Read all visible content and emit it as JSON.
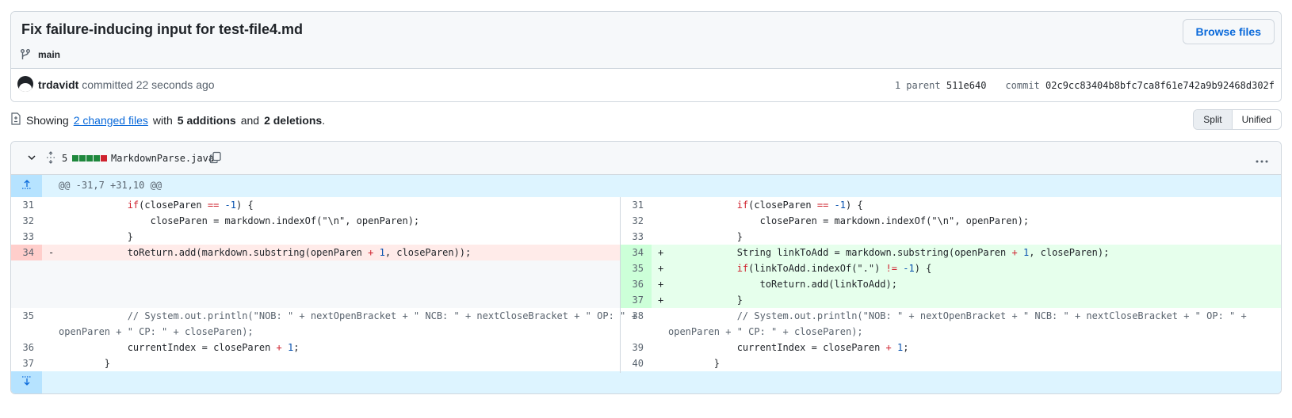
{
  "commit": {
    "title": "Fix failure-inducing input for test-file4.md",
    "branch": "main",
    "browse_button": "Browse files",
    "author": "trdavidt",
    "action": "committed 22 seconds ago",
    "parent_label": "1 parent",
    "parent_sha": "511e640",
    "commit_label": "commit",
    "commit_sha": "02c9cc83404b8bfc7ca8f61e742a9b92468d302f"
  },
  "summary": {
    "prefix": "Showing",
    "changed_files": "2 changed files",
    "with": "with",
    "additions": "5 additions",
    "and": "and",
    "deletions": "2 deletions",
    "suffix": "."
  },
  "view_toggle": {
    "split": "Split",
    "unified": "Unified",
    "active": "Split"
  },
  "file": {
    "change_count": "5",
    "name": "MarkdownParse.java",
    "diffstat_colors": [
      "#1f883d",
      "#1f883d",
      "#1f883d",
      "#1f883d",
      "#cf222e"
    ],
    "hunk_header": "@@ -31,7 +31,10 @@",
    "more_icon": "kebab-horizontal-icon"
  },
  "diff_lines": {
    "l31": "31",
    "l32": "32",
    "l33": "33",
    "l34": "34",
    "l35": "35",
    "l36": "36",
    "l37": "37",
    "r31": "31",
    "r32": "32",
    "r33": "33",
    "r34": "34",
    "r35": "35",
    "r36": "36",
    "r37": "37",
    "r38": "38",
    "r39": "39",
    "r40": "40",
    "minus": "-",
    "plus": "+",
    "c_if_a": "            ",
    "c_if_kw": "if",
    "c_if_b": "(closeParen ",
    "c_if_eq": "==",
    "c_if_c": " ",
    "c_if_neg": "-1",
    "c_if_d": ") {",
    "c_close": "                closeParen = markdown.indexOf(\"\\n\", openParen);",
    "c_brace": "            }",
    "c_del_a": "            toReturn.add(markdown.substring(openParen ",
    "c_plus_op": "+",
    "c_one": "1",
    "c_del_b": ", closeParen));",
    "c_add1_a": "            String linkToAdd = markdown.substring(openParen ",
    "c_add1_b": ", closeParen);",
    "c_add2_a": "            ",
    "c_add2_kw": "if",
    "c_add2_b": "(linkToAdd.indexOf(\".\") ",
    "c_add2_ne": "!=",
    "c_add2_c": " ",
    "c_add2_neg": "-1",
    "c_add2_d": ") {",
    "c_add3": "                toReturn.add(linkToAdd);",
    "c_add4": "            }",
    "c_comment_1": "            // System.out.println(\"NOB: \" + nextOpenBracket + \" NCB: \" + nextCloseBracket + \" OP: \" +",
    "c_comment_2": "openParen + \" CP: \" + closeParen);",
    "c_cur_a": "            currentIndex = closeParen ",
    "c_cur_b": ";",
    "c_end": "        }"
  }
}
